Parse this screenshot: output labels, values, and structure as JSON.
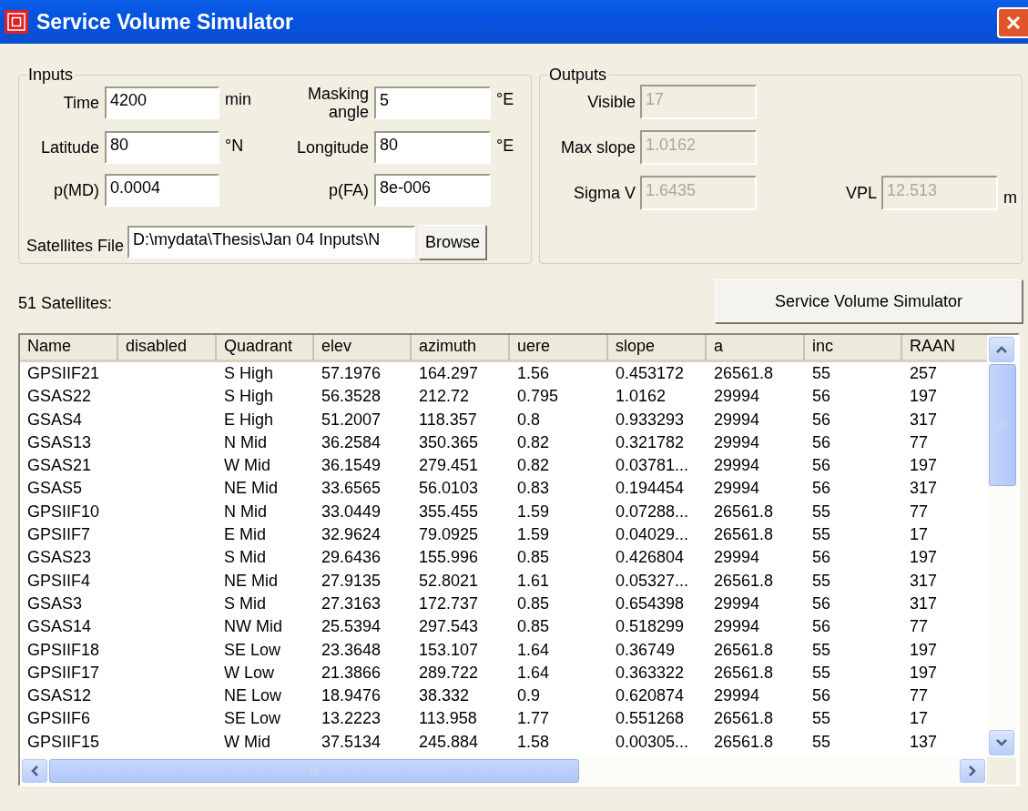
{
  "window": {
    "title": "Service Volume Simulator"
  },
  "inputs": {
    "title": "Inputs",
    "fields": [
      {
        "label": "Time",
        "value": "4200",
        "unit": "min",
        "disabled": false
      },
      {
        "label": "Masking angle",
        "value": "5",
        "unit": "°E",
        "disabled": false
      },
      {
        "label": "Latitude",
        "value": "80",
        "unit": "°N",
        "disabled": false
      },
      {
        "label": "Longitude",
        "value": "80",
        "unit": "°E",
        "disabled": false
      },
      {
        "label": "p(MD)",
        "value": "0.0004",
        "disabled": false
      },
      {
        "label": "p(FA)",
        "value": "8e-006",
        "disabled": false
      }
    ],
    "satellites_file": {
      "label": "Satellites File",
      "value": "D:\\mydata\\Thesis\\Jan 04 Inputs\\N"
    },
    "browse_button": "Browse"
  },
  "outputs": {
    "title": "Outputs",
    "fields": [
      {
        "label": "Visible",
        "value": "17",
        "disabled": true
      },
      {
        "label": "Max slope",
        "value": "1.0162",
        "disabled": true
      },
      {
        "label": "Sigma V",
        "value": "1.6435",
        "disabled": true
      }
    ],
    "vpl": {
      "label": "VPL",
      "value": "12.513",
      "unit": "m",
      "disabled": true
    }
  },
  "satellite_count": "51 Satellites:",
  "simulate_button": "Service Volume Simulator",
  "table": {
    "columns": [
      "Name",
      "disabled",
      "Quadrant",
      "elev",
      "azimuth",
      "uere",
      "slope",
      "a",
      "inc",
      "RAAN"
    ],
    "rows": [
      [
        "GPSIIF21",
        "",
        "S High",
        "57.1976",
        "164.297",
        "1.56",
        "0.453172",
        "26561.8",
        "55",
        "257"
      ],
      [
        "GSAS22",
        "",
        "S High",
        "56.3528",
        "212.72",
        "0.795",
        "1.0162",
        "29994",
        "56",
        "197"
      ],
      [
        "GSAS4",
        "",
        "E High",
        "51.2007",
        "118.357",
        "0.8",
        "0.933293",
        "29994",
        "56",
        "317"
      ],
      [
        "GSAS13",
        "",
        "N Mid",
        "36.2584",
        "350.365",
        "0.82",
        "0.321782",
        "29994",
        "56",
        "77"
      ],
      [
        "GSAS21",
        "",
        "W Mid",
        "36.1549",
        "279.451",
        "0.82",
        "0.03781...",
        "29994",
        "56",
        "197"
      ],
      [
        "GSAS5",
        "",
        "NE Mid",
        "33.6565",
        "56.0103",
        "0.83",
        "0.194454",
        "29994",
        "56",
        "317"
      ],
      [
        "GPSIIF10",
        "",
        "N Mid",
        "33.0449",
        "355.455",
        "1.59",
        "0.07288...",
        "26561.8",
        "55",
        "77"
      ],
      [
        "GPSIIF7",
        "",
        "E Mid",
        "32.9624",
        "79.0925",
        "1.59",
        "0.04029...",
        "26561.8",
        "55",
        "17"
      ],
      [
        "GSAS23",
        "",
        "S Mid",
        "29.6436",
        "155.996",
        "0.85",
        "0.426804",
        "29994",
        "56",
        "197"
      ],
      [
        "GPSIIF4",
        "",
        "NE Mid",
        "27.9135",
        "52.8021",
        "1.61",
        "0.05327...",
        "26561.8",
        "55",
        "317"
      ],
      [
        "GSAS3",
        "",
        "S Mid",
        "27.3163",
        "172.737",
        "0.85",
        "0.654398",
        "29994",
        "56",
        "317"
      ],
      [
        "GSAS14",
        "",
        "NW Mid",
        "25.5394",
        "297.543",
        "0.85",
        "0.518299",
        "29994",
        "56",
        "77"
      ],
      [
        "GPSIIF18",
        "",
        "SE Low",
        "23.3648",
        "153.107",
        "1.64",
        "0.36749",
        "26561.8",
        "55",
        "197"
      ],
      [
        "GPSIIF17",
        "",
        "W Low",
        "21.3866",
        "289.722",
        "1.64",
        "0.363322",
        "26561.8",
        "55",
        "197"
      ],
      [
        "GSAS12",
        "",
        "NE Low",
        "18.9476",
        "38.332",
        "0.9",
        "0.620874",
        "29994",
        "56",
        "77"
      ],
      [
        "GPSIIF6",
        "",
        "SE Low",
        "13.2223",
        "113.958",
        "1.77",
        "0.551268",
        "26561.8",
        "55",
        "17"
      ],
      [
        "GPSIIF15",
        "",
        "W Mid",
        "37.5134",
        "245.884",
        "1.58",
        "0.00305...",
        "26561.8",
        "55",
        "137"
      ]
    ]
  }
}
